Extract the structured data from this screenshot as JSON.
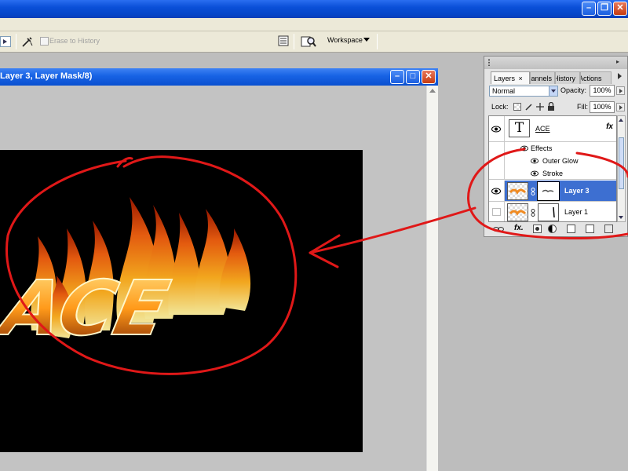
{
  "options_bar": {
    "erase_to_history_label": "Erase to History",
    "workspace_label": "Workspace"
  },
  "document": {
    "title": "Layer 3, Layer Mask/8)",
    "canvas_text": "ACE"
  },
  "layers_panel": {
    "tabs": [
      {
        "label": "Layers",
        "close": "×"
      },
      {
        "label": "Channels"
      },
      {
        "label": "History"
      },
      {
        "label": "Actions"
      }
    ],
    "blend_mode": "Normal",
    "opacity_label": "Opacity:",
    "opacity_value": "100%",
    "lock_label": "Lock:",
    "fill_label": "Fill:",
    "fill_value": "100%",
    "layers": [
      {
        "name": "ACE",
        "type": "text",
        "thumb_glyph": "T",
        "fx": "fx",
        "visible": true
      },
      {
        "name": "Effects",
        "type": "effects-group",
        "visible": true
      },
      {
        "name": "Outer Glow",
        "type": "effect",
        "visible": true
      },
      {
        "name": "Stroke",
        "type": "effect",
        "visible": true
      },
      {
        "name": "Layer 3",
        "type": "masked",
        "selected": true,
        "visible": true
      },
      {
        "name": "Layer 1",
        "type": "masked",
        "visible": false
      }
    ]
  },
  "colors": {
    "xp_blue": "#0a4fd8",
    "selection": "#3d6fd1",
    "annotation_red": "#e01818"
  }
}
